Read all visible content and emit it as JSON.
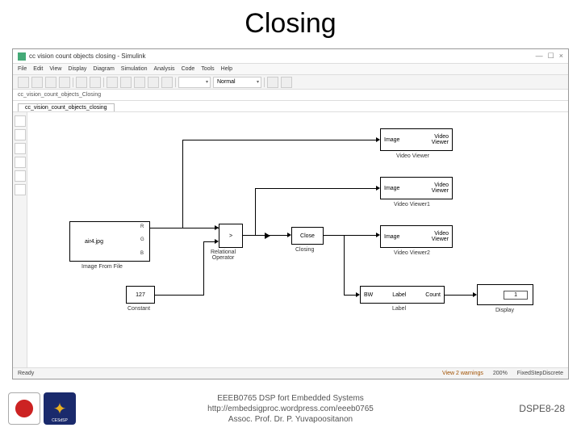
{
  "slide": {
    "title": "Closing",
    "number": "DSPE8-28",
    "footer_line1": "EEEB0765 DSP fort Embedded Systems",
    "footer_line2": "http://embedsigproc.wordpress.com/eeeb0765",
    "footer_line3": "Assoc. Prof. Dr. P. Yuvapoositanon",
    "logo2_text": "CESdSP"
  },
  "window": {
    "title": "cc vision count objects closing - Simulink",
    "min": "—",
    "max": "☐",
    "close": "×"
  },
  "menu": [
    "File",
    "Edit",
    "View",
    "Display",
    "Diagram",
    "Simulation",
    "Analysis",
    "Code",
    "Tools",
    "Help"
  ],
  "toolbar": {
    "dropdown_normal": "Normal"
  },
  "breadcrumb": "cc_vision_count_objects_Closing",
  "tab": "cc_vision_count_objects_closing",
  "status": {
    "ready": "Ready",
    "warn": "View 2 warnings",
    "zoom": "200%",
    "solver": "FixedStepDiscrete"
  },
  "blocks": {
    "image_from_file": {
      "text": "air4.jpg",
      "label": "Image From File",
      "ports": [
        "R",
        "G",
        "B"
      ]
    },
    "constant": {
      "text": "127",
      "label": "Constant"
    },
    "relop": {
      "text": ">",
      "label": "Relational\nOperator"
    },
    "closing": {
      "text": "Close",
      "label": "Closing"
    },
    "labeling": {
      "text_left": "BW",
      "text_mid": "Label",
      "text_right": "Count",
      "label": "Label"
    },
    "display": {
      "text": "1",
      "label": "Display"
    },
    "viewer0": {
      "text_left": "Image",
      "text_right": "Video\nViewer",
      "label": "Video Viewer"
    },
    "viewer1": {
      "text_left": "Image",
      "text_right": "Video\nViewer",
      "label": "Video Viewer1"
    },
    "viewer2": {
      "text_left": "Image",
      "text_right": "Video\nViewer",
      "label": "Video Viewer2"
    }
  }
}
